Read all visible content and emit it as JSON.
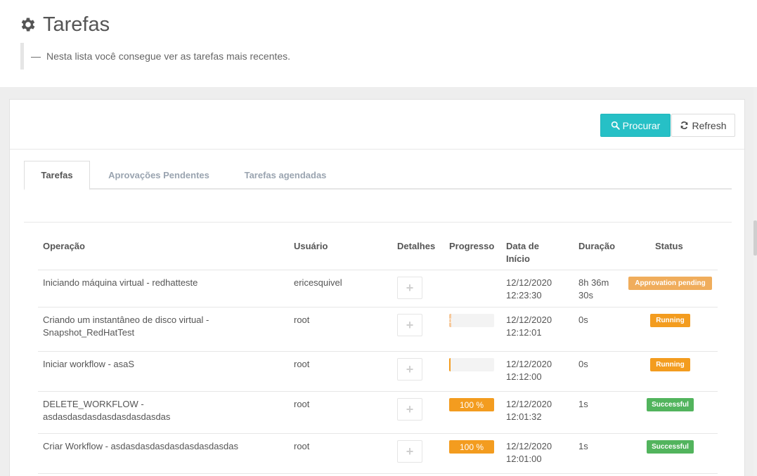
{
  "header": {
    "title": "Tarefas",
    "subtitle_dash": "—",
    "subtitle": "Nesta lista você consegue ver as tarefas mais recentes."
  },
  "toolbar": {
    "search_label": "Procurar",
    "refresh_label": "Refresh"
  },
  "tabs": [
    {
      "label": "Tarefas",
      "active": true
    },
    {
      "label": "Aprovações Pendentes",
      "active": false
    },
    {
      "label": "Tarefas agendadas",
      "active": false
    }
  ],
  "table": {
    "columns": {
      "operation": "Operação",
      "user": "Usuário",
      "details": "Detalhes",
      "progress": "Progresso",
      "start_date_line1": "Data de",
      "start_date_line2": "Início",
      "duration": "Duração",
      "status": "Status"
    },
    "details_icon": "plus-icon",
    "rows": [
      {
        "operation_line1": "Iniciando máquina virtual - redhatteste",
        "operation_line2": "",
        "user": "ericesquivel",
        "progress": null,
        "progress_label": "",
        "date": "12/12/2020",
        "time": "12:23:30",
        "duration_line1": "8h 36m",
        "duration_line2": "30s",
        "status": "Approvation pending",
        "status_kind": "pending"
      },
      {
        "operation_line1": "Criando um instantâneo de disco virtual -",
        "operation_line2": "Snapshot_RedHatTest",
        "user": "root",
        "progress": 0,
        "progress_label": "0",
        "date": "12/12/2020",
        "time": "12:12:01",
        "duration_line1": "0s",
        "duration_line2": "",
        "status": "Running",
        "status_kind": "running"
      },
      {
        "operation_line1": "Iniciar workflow - asaS",
        "operation_line2": "",
        "user": "root",
        "progress": 2,
        "progress_label": "",
        "date": "12/12/2020",
        "time": "12:12:00",
        "duration_line1": "0s",
        "duration_line2": "",
        "status": "Running",
        "status_kind": "running"
      },
      {
        "operation_line1": "DELETE_WORKFLOW -",
        "operation_line2": "asdasdasdasdasdasdasdasdas",
        "user": "root",
        "progress": 100,
        "progress_label": "100 %",
        "date": "12/12/2020",
        "time": "12:01:32",
        "duration_line1": "1s",
        "duration_line2": "",
        "status": "Successful",
        "status_kind": "success"
      },
      {
        "operation_line1": "Criar Workflow - asdasdasdasdasdasdasdasdas",
        "operation_line2": "",
        "user": "root",
        "progress": 100,
        "progress_label": "100 %",
        "date": "12/12/2020",
        "time": "12:01:00",
        "duration_line1": "1s",
        "duration_line2": "",
        "status": "Successful",
        "status_kind": "success"
      }
    ]
  }
}
